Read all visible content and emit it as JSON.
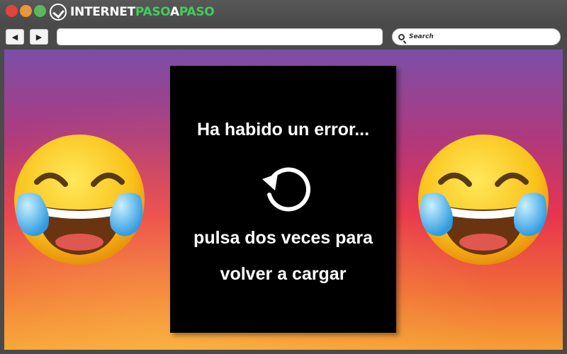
{
  "window": {
    "controls": [
      "close",
      "minimize",
      "maximize"
    ],
    "logo": {
      "part1": "INTERNET",
      "part2": "PASO",
      "part3": "A",
      "part4": "PASO"
    }
  },
  "toolbar": {
    "back_icon": "◀",
    "forward_icon": "▶",
    "url_value": "",
    "search_placeholder": "Search"
  },
  "error": {
    "title": "Ha habido un error...",
    "line1": "pulsa dos veces para",
    "line2": "volver a cargar"
  },
  "icons": {
    "reload": "reload-icon",
    "emoji": "face-with-tears-of-joy-icon"
  },
  "colors": {
    "close": "#e0443e",
    "minimize": "#e9963c",
    "maximize": "#5cb85c",
    "logo_accent": "#3fcf5a",
    "card": "#000000",
    "card_text": "#ffffff"
  }
}
